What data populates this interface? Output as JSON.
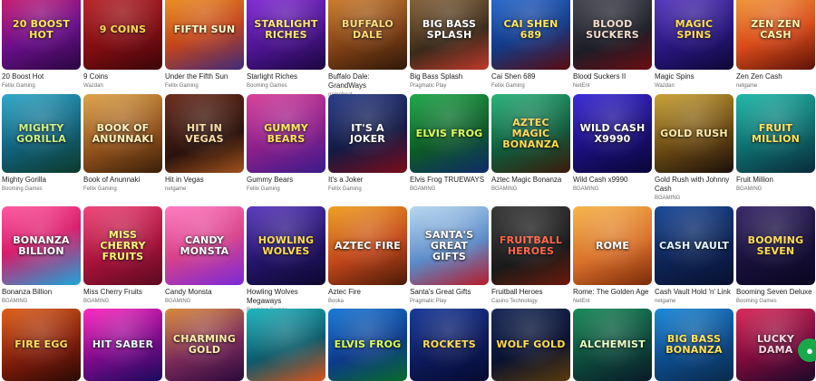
{
  "games": [
    {
      "title": "20 Boost Hot",
      "provider": "Fellix Gaming",
      "art": "20 BOOST HOT",
      "bg": "linear-gradient(160deg,#d81b6a,#6b0f8a 55%,#2a0640)",
      "fg": "#ffe14a"
    },
    {
      "title": "9 Coins",
      "provider": "Wazdan",
      "art": "9 COINS",
      "bg": "linear-gradient(160deg,#c0252a,#7d0d12 60%,#3a0508)",
      "fg": "#ffd23f"
    },
    {
      "title": "Under the Fifth Sun",
      "provider": "Fellix Gaming",
      "art": "FIFTH SUN",
      "bg": "linear-gradient(160deg,#f29a1a,#c2441b 55%,#3f2a7a)",
      "fg": "#fff6c0"
    },
    {
      "title": "Starlight Riches",
      "provider": "Booming Games",
      "art": "STARLIGHT RICHES",
      "bg": "linear-gradient(160deg,#8a2be2,#4a148c 60%,#1a0640)",
      "fg": "#ffe36b"
    },
    {
      "title": "Buffalo Dale: GrandWays",
      "provider": "gamebeat",
      "art": "BUFFALO DALE",
      "bg": "linear-gradient(160deg,#d9862c,#7a3d14 60%,#2f1808)",
      "fg": "#ffd76a"
    },
    {
      "title": "Big Bass Splash",
      "provider": "Pragmatic Play",
      "art": "BIG BASS SPLASH",
      "bg": "linear-gradient(160deg,#8f6a3d,#3b2a1a 60%,#c0392b)",
      "fg": "#ffffff"
    },
    {
      "title": "Cai Shen 689",
      "provider": "Fellix Gaming",
      "art": "CAI SHEN 689",
      "bg": "linear-gradient(160deg,#2a6fd8,#123a8a 55%,#5a0c0c)",
      "fg": "#ffe44d"
    },
    {
      "title": "Blood Suckers II",
      "provider": "NetEnt",
      "art": "BLOOD SUCKERS",
      "bg": "linear-gradient(160deg,#4a4a57,#1d1d27 60%,#6b0c12)",
      "fg": "#f1d9c8"
    },
    {
      "title": "Magic Spins",
      "provider": "Wazdan",
      "art": "MAGIC SPINS",
      "bg": "linear-gradient(160deg,#5c3bc9,#27157a 60%,#0e0736)",
      "fg": "#ffd84a"
    },
    {
      "title": "Zen Zen Cash",
      "provider": "netgame",
      "art": "ZEN ZEN CASH",
      "bg": "linear-gradient(160deg,#f3a33a,#d94b1a 55%,#5c1208)",
      "fg": "#fff3a0"
    },
    {
      "title": "Mighty Gorilla",
      "provider": "Booming Games",
      "art": "MIGHTY GORILLA",
      "bg": "linear-gradient(160deg,#2fa8c9,#11607a 55%,#0c3a2a)",
      "fg": "#c4f27a"
    },
    {
      "title": "Book of Anunnaki",
      "provider": "Fellix Gaming",
      "art": "BOOK OF ANUNNAKI",
      "bg": "linear-gradient(160deg,#e0a44a,#8a4d1a 60%,#3a1f0a)",
      "fg": "#fff0b5"
    },
    {
      "title": "Hit in Vegas",
      "provider": "netgame",
      "art": "HIT IN VEGAS",
      "bg": "linear-gradient(160deg,#6b2d1d,#2b120c 60%,#a0521d)",
      "fg": "#ffd9a0"
    },
    {
      "title": "Gummy Bears",
      "provider": "Fellix Gaming",
      "art": "GUMMY BEARS",
      "bg": "linear-gradient(160deg,#d8419a,#8a1f8a 55%,#3a1b8a)",
      "fg": "#ffe34d"
    },
    {
      "title": "It's a Joker",
      "provider": "Fellix Gaming",
      "art": "IT'S A JOKER",
      "bg": "linear-gradient(160deg,#2a3d8a,#141a44 55%,#7a0c1a)",
      "fg": "#ffffff"
    },
    {
      "title": "Elvis Frog TRUEWAYS",
      "provider": "BGAMING",
      "art": "ELVIS FROG",
      "bg": "linear-gradient(160deg,#1fa84a,#0d5a26 55%,#102a6a)",
      "fg": "#d8ff4a"
    },
    {
      "title": "Aztec Magic Bonanza",
      "provider": "BGAMING",
      "art": "AZTEC MAGIC BONANZA",
      "bg": "linear-gradient(160deg,#2bb37a,#0f5c3d 55%,#3a1a0a)",
      "fg": "#ffd84a"
    },
    {
      "title": "Wild Cash x9990",
      "provider": "BGAMING",
      "art": "WILD CASH X9990",
      "bg": "linear-gradient(160deg,#3b2ad8,#1a0f7a 55%,#0a0636)",
      "fg": "#ffffff"
    },
    {
      "title": "Gold Rush with Johnny Cash",
      "provider": "BGAMING",
      "art": "GOLD RUSH",
      "bg": "linear-gradient(160deg,#c9a233,#6b4a12 55%,#1a0f0a)",
      "fg": "#ffe9a0"
    },
    {
      "title": "Fruit Million",
      "provider": "BGAMING",
      "art": "FRUIT MILLION",
      "bg": "linear-gradient(160deg,#1fb8a8,#0d6b6b 55%,#0a2a3a)",
      "fg": "#ffe24a"
    },
    {
      "title": "Bonanza Billion",
      "provider": "BGAMING",
      "art": "BONANZA BILLION",
      "bg": "linear-gradient(160deg,#ff5aa0,#d81b6a 45%,#1aa7d8)",
      "fg": "#ffffff"
    },
    {
      "title": "Miss Cherry Fruits",
      "provider": "BGAMING",
      "art": "MISS CHERRY FRUITS",
      "bg": "linear-gradient(160deg,#f0467a,#a8123a 55%,#5a0a1f)",
      "fg": "#fff26a"
    },
    {
      "title": "Candy Monsta",
      "provider": "BGAMING",
      "art": "CANDY MONSTA",
      "bg": "linear-gradient(160deg,#ff7ac2,#d8418a 50%,#7a2ad8)",
      "fg": "#ffffff"
    },
    {
      "title": "Howling Wolves Megaways",
      "provider": "Booming Games",
      "art": "HOWLING WOLVES",
      "bg": "linear-gradient(160deg,#5a3bc0,#241468 55%,#0d0830)",
      "fg": "#ffd84a"
    },
    {
      "title": "Aztec Fire",
      "provider": "Booka",
      "art": "AZTEC FIRE",
      "bg": "linear-gradient(160deg,#f0a020,#c0451a 55%,#4a1a08)",
      "fg": "#ffffff"
    },
    {
      "title": "Santa's Great Gifts",
      "provider": "Pragmatic Play",
      "art": "SANTA'S GREAT GIFTS",
      "bg": "linear-gradient(160deg,#b8d8f0,#5a8ac8 55%,#b81a2a)",
      "fg": "#ffffff"
    },
    {
      "title": "Fruitball Heroes",
      "provider": "Casino Technology",
      "art": "FRUITBALL HEROES",
      "bg": "linear-gradient(160deg,#3a3a3a,#1a1a1a 60%,#6a1a0a)",
      "fg": "#ff5a3a"
    },
    {
      "title": "Rome: The Golden Age",
      "provider": "NetEnt",
      "art": "ROME",
      "bg": "linear-gradient(160deg,#f7b54a,#d8702a 55%,#7a2a0a)",
      "fg": "#ffffff"
    },
    {
      "title": "Cash Vault Hold 'n' Link",
      "provider": "netgame",
      "art": "CASH VAULT",
      "bg": "linear-gradient(160deg,#1a4a9a,#0d2455 55%,#081030)",
      "fg": "#dff4ff"
    },
    {
      "title": "Booming Seven Deluxe",
      "provider": "Booming Games",
      "art": "BOOMING SEVEN",
      "bg": "linear-gradient(160deg,#3a2a6a,#18103a 55%,#0a0620)",
      "fg": "#ffd84a"
    },
    {
      "title": "",
      "provider": "",
      "art": "FIRE EGG",
      "bg": "linear-gradient(160deg,#e0601a,#7a1a0a 60%,#2a0a05)",
      "fg": "#ffd84a"
    },
    {
      "title": "",
      "provider": "",
      "art": "HIT SABER",
      "bg": "linear-gradient(160deg,#ff2ac0,#7a0a8a 55%,#1a0a5a)",
      "fg": "#e8f4ff"
    },
    {
      "title": "",
      "provider": "",
      "art": "CHARMING GOLD",
      "bg": "linear-gradient(160deg,#d98a3a,#7a2a5a 55%,#2a0a3a)",
      "fg": "#ffe9a0"
    },
    {
      "title": "",
      "provider": "",
      "art": "",
      "bg": "linear-gradient(160deg,#1fb8c0,#0d5a6a 55%,#d8541a)",
      "fg": "#ffffff"
    },
    {
      "title": "",
      "provider": "",
      "art": "ELVIS FROG",
      "bg": "linear-gradient(160deg,#1a7ad8,#0d3a8a 55%,#0a6a2a)",
      "fg": "#d8ff4a"
    },
    {
      "title": "",
      "provider": "",
      "art": "ROCKETS",
      "bg": "linear-gradient(160deg,#1a3a9a,#0d1a5a 55%,#050a30)",
      "fg": "#ffd84a"
    },
    {
      "title": "",
      "provider": "",
      "art": "WOLF GOLD",
      "bg": "linear-gradient(160deg,#1a2a5a,#0a1230 55%,#5a3a0a)",
      "fg": "#ffd84a"
    },
    {
      "title": "",
      "provider": "",
      "art": "ALCHEMIST",
      "bg": "linear-gradient(160deg,#1a8a5a,#0d4a3a 55%,#0a1a2a)",
      "fg": "#eaffc0"
    },
    {
      "title": "",
      "provider": "",
      "art": "BIG BASS BONANZA",
      "bg": "linear-gradient(160deg,#1a8ad8,#0d4a8a 55%,#0a2a4a)",
      "fg": "#ffe24a"
    },
    {
      "title": "",
      "provider": "",
      "art": "LUCKY DAMA",
      "bg": "linear-gradient(160deg,#d82a5a,#7a0a3a 55%,#1a0a2a)",
      "fg": "#ffd0e0"
    }
  ],
  "chat_icon": "chat-bubble-icon",
  "chat_color": "#17a84a"
}
